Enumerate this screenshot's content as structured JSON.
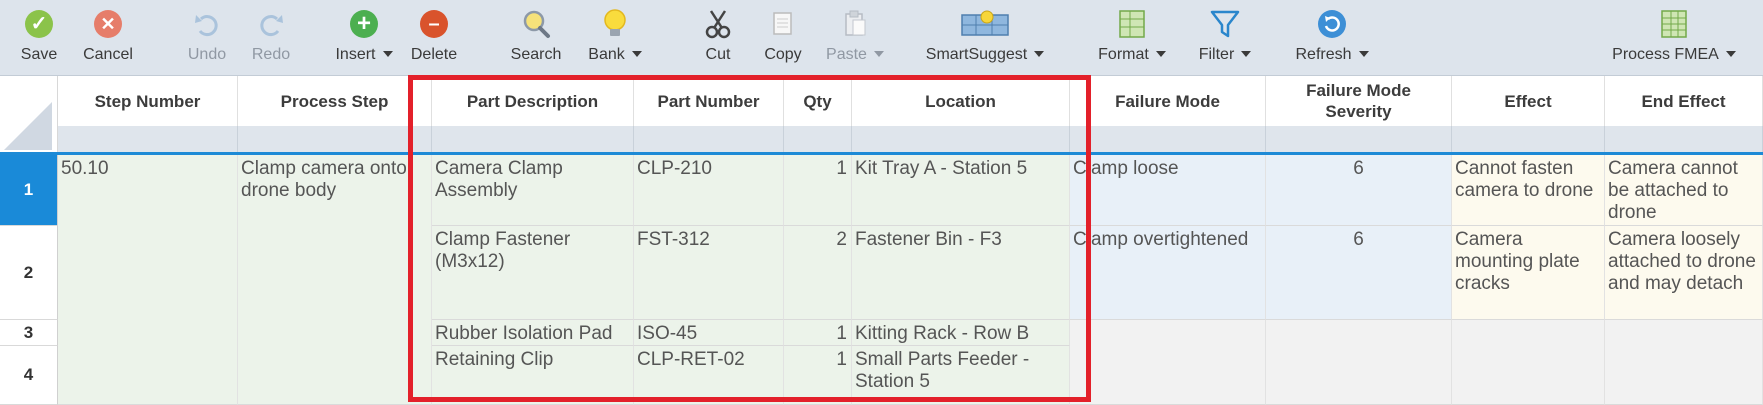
{
  "toolbar": {
    "save": "Save",
    "cancel": "Cancel",
    "undo": "Undo",
    "redo": "Redo",
    "insert": "Insert",
    "delete": "Delete",
    "search": "Search",
    "bank": "Bank",
    "cut": "Cut",
    "copy": "Copy",
    "paste": "Paste",
    "smartsuggest": "SmartSuggest",
    "format": "Format",
    "filter": "Filter",
    "refresh": "Refresh",
    "view": "Process FMEA"
  },
  "colors": {
    "selection": "#1a8ad8",
    "highlight_box": "#e3202a",
    "save_green": "#8bc34a",
    "cancel_red": "#e67d6a",
    "insert_green": "#4caf50",
    "delete_red": "#d9532c"
  },
  "columns": {
    "step_number": "Step Number",
    "process_step": "Process Step",
    "part_description": "Part Description",
    "part_number": "Part Number",
    "qty": "Qty",
    "location": "Location",
    "failure_mode": "Failure Mode",
    "severity": "Failure Mode Severity",
    "effect": "Effect",
    "end_effect": "End Effect"
  },
  "rows": [
    {
      "num": "1",
      "part_description": "Camera Clamp Assembly",
      "part_number": "CLP-210",
      "qty": "1",
      "location": "Kit Tray A - Station 5",
      "failure_mode": "Clamp loose",
      "severity": "6",
      "effect": "Cannot fasten camera to drone",
      "end_effect": "Camera cannot be attached to drone"
    },
    {
      "num": "2",
      "part_description": "Clamp Fastener (M3x12)",
      "part_number": "FST-312",
      "qty": "2",
      "location": "Fastener Bin - F3",
      "failure_mode": "Clamp overtightened",
      "severity": "6",
      "effect": "Camera mounting plate cracks",
      "end_effect": "Camera loosely attached to drone and may detach"
    },
    {
      "num": "3",
      "part_description": "Rubber Isolation Pad",
      "part_number": "ISO-45",
      "qty": "1",
      "location": "Kitting Rack - Row B"
    },
    {
      "num": "4",
      "part_description": "Retaining Clip",
      "part_number": "CLP-RET-02",
      "qty": "1",
      "location": "Small Parts Feeder - Station 5"
    }
  ],
  "step": {
    "number": "50.10",
    "process": "Clamp camera onto drone body"
  }
}
